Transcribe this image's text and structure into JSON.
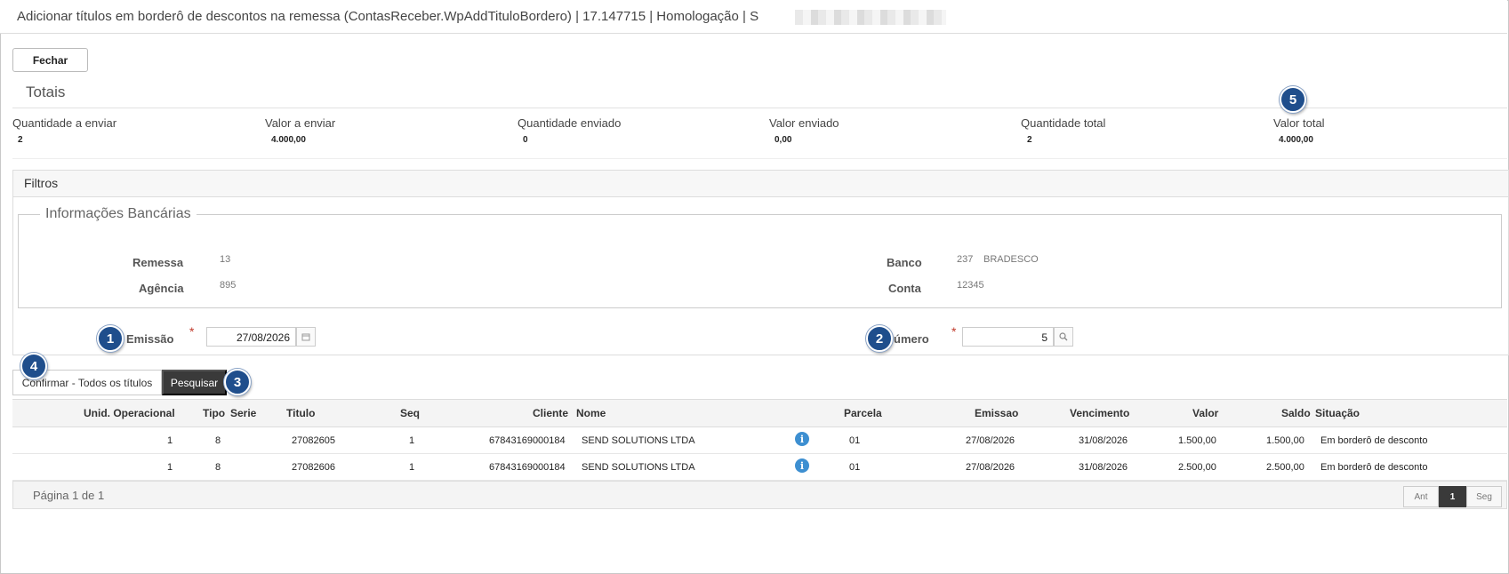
{
  "window": {
    "title": "Adicionar títulos em borderô de descontos na remessa (ContasReceber.WpAddTituloBordero) | 17.147715 | Homologação | S"
  },
  "toolbar": {
    "close_label": "Fechar"
  },
  "totals": {
    "section_title": "Totais",
    "items": [
      {
        "label": "Quantidade a enviar",
        "value": "2"
      },
      {
        "label": "Valor a enviar",
        "value": "4.000,00"
      },
      {
        "label": "Quantidade enviado",
        "value": "0"
      },
      {
        "label": "Valor enviado",
        "value": "0,00"
      },
      {
        "label": "Quantidade total",
        "value": "2"
      },
      {
        "label": "Valor total",
        "value": "4.000,00"
      }
    ]
  },
  "filters": {
    "panel_title": "Filtros",
    "bank_info": {
      "legend": "Informações Bancárias",
      "remessa_label": "Remessa",
      "remessa_value": "13",
      "agencia_label": "Agência",
      "agencia_value": "895",
      "banco_label": "Banco",
      "banco_code": "237",
      "banco_name": "BRADESCO",
      "conta_label": "Conta",
      "conta_value": "12345"
    },
    "emissao_label": "Emissão",
    "emissao_value": "27/08/2026",
    "numero_label": "úmero",
    "numero_value": "5",
    "required_mark": "*"
  },
  "actions": {
    "confirm_label": "Confirmar - Todos os títulos",
    "search_label": "Pesquisar"
  },
  "annotations": [
    "1",
    "2",
    "3",
    "4",
    "5"
  ],
  "table": {
    "columns": [
      "Unid. Operacional",
      "Tipo",
      "Serie",
      "Titulo",
      "Seq",
      "Cliente",
      "Nome",
      "Parcela",
      "Emissao",
      "Vencimento",
      "Valor",
      "Saldo",
      "Situação"
    ],
    "rows": [
      {
        "unid": "1",
        "tipo": "8",
        "serie": "",
        "titulo": "27082605",
        "seq": "1",
        "cliente": "67843169000184",
        "nome": "SEND SOLUTIONS LTDA",
        "parcela": "01",
        "emissao": "27/08/2026",
        "vencimento": "31/08/2026",
        "valor": "1.500,00",
        "saldo": "1.500,00",
        "situacao": "Em borderô de desconto"
      },
      {
        "unid": "1",
        "tipo": "8",
        "serie": "",
        "titulo": "27082606",
        "seq": "1",
        "cliente": "67843169000184",
        "nome": "SEND SOLUTIONS LTDA",
        "parcela": "01",
        "emissao": "27/08/2026",
        "vencimento": "31/08/2026",
        "valor": "2.500,00",
        "saldo": "2.500,00",
        "situacao": "Em borderô de desconto"
      }
    ]
  },
  "pagination": {
    "summary": "Página 1 de 1",
    "prev_label": "Ant",
    "current_page": "1",
    "next_label": "Seg"
  },
  "colors": {
    "badge": "#1f4e8c",
    "primary_button": "#3a3a3a",
    "info_icon": "#3d8fd1",
    "required": "#c0392b"
  }
}
